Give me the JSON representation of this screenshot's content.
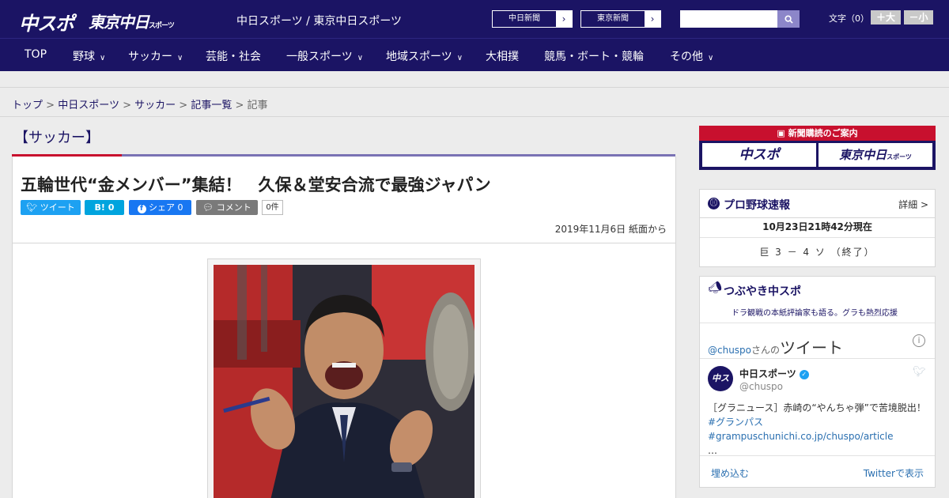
{
  "header": {
    "logo_main": "中スポ",
    "logo_tokyo": "東京中日",
    "logo_tokyo_small": "スポーツ",
    "site_title": "中日スポーツ / 東京中日スポーツ",
    "paper_links": [
      "中日新聞",
      "東京新聞"
    ],
    "search_placeholder": "",
    "font_size_label": "文字（0）",
    "font_bigger": "＋大",
    "font_smaller": "－小"
  },
  "nav": [
    {
      "label": "TOP",
      "has_menu": false
    },
    {
      "label": "野球",
      "has_menu": true
    },
    {
      "label": "サッカー",
      "has_menu": true
    },
    {
      "label": "芸能・社会",
      "has_menu": false
    },
    {
      "label": "一般スポーツ",
      "has_menu": true
    },
    {
      "label": "地域スポーツ",
      "has_menu": true
    },
    {
      "label": "大相撲",
      "has_menu": false
    },
    {
      "label": "競馬・ボート・競輪",
      "has_menu": false
    },
    {
      "label": "その他",
      "has_menu": true
    }
  ],
  "breadcrumb": {
    "items": [
      "トップ",
      "中日スポーツ",
      "サッカー",
      "記事一覧"
    ],
    "current": "記事",
    "separator": ">"
  },
  "article": {
    "category": "【サッカー】",
    "title": "五輪世代“金メンバー”集結！　久保＆堂安合流で最強ジャパン",
    "share": {
      "tweet": "ツイート",
      "hatena": "B!",
      "hatena_count": "0",
      "facebook": "シェア",
      "facebook_count": "0",
      "comment": "コメント",
      "comment_count": "0件"
    },
    "date": "2019年11月6日 紙面から"
  },
  "sidebar": {
    "ad": {
      "title": "新聞購読のご案内",
      "tile_a": "中スポ",
      "tile_b": "東京中日",
      "tile_b_small": "スポーツ"
    },
    "baseball": {
      "title": "プロ野球速報",
      "detail": "詳細 >",
      "time": "10月23日21時42分現在",
      "score": "巨 3 － 4 ソ （終了）"
    },
    "twitter": {
      "title": "つぶやき中スポ",
      "subtitle": "ドラ観戦の本紙評論家も語る。グラも熱烈応援",
      "handle": "@chuspo",
      "san": "さんの",
      "tweet_word": "ツイート",
      "account_name": "中日スポーツ",
      "account_id": "@chuspo",
      "avatar_text": "中スポ",
      "tweet_text": "［グラニュース］赤崎の“やんちゃ弾”で苦境脱出！",
      "tweet_tag1": "#グランパス",
      "tweet_link": "#grampuschunichi.co.jp/chuspo/article",
      "tweet_ellipsis": "…",
      "embed": "埋め込む",
      "view_on": "Twitterで表示"
    }
  },
  "colors": {
    "brand_navy": "#1b1464",
    "accent_red": "#c8102e",
    "twitter_blue": "#1da1f2",
    "facebook_blue": "#1877f2",
    "hatena_blue": "#00a4de"
  }
}
